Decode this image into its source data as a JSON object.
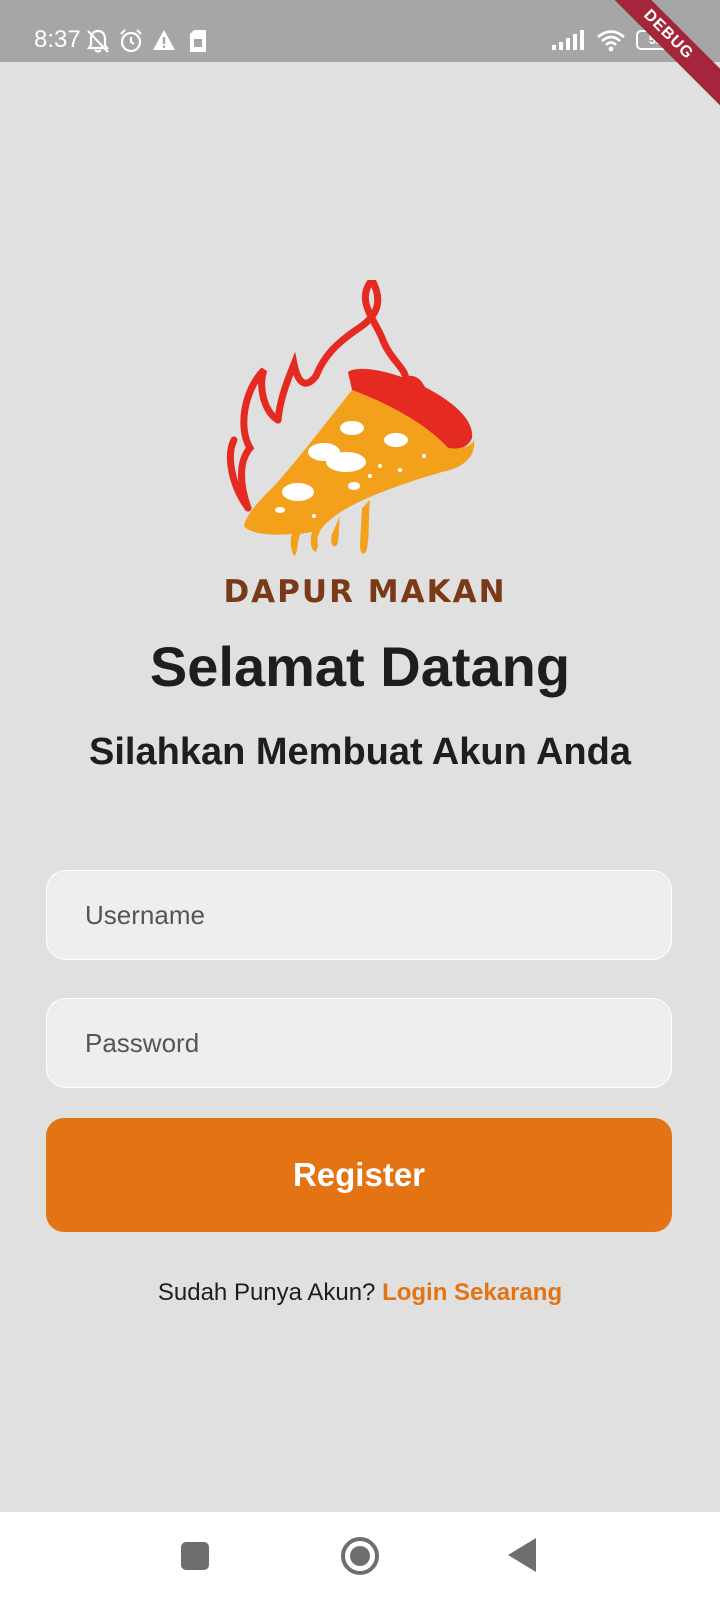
{
  "status_bar": {
    "time": "8:37",
    "battery": "52",
    "icons": [
      "notifications-off-icon",
      "alarm-icon",
      "warning-icon",
      "sim-icon",
      "signal-icon",
      "wifi-icon",
      "battery-icon"
    ]
  },
  "debug_banner": "DEBUG",
  "logo": {
    "brand_name": "DAPUR MAKAN",
    "icon": "pizza-flame-logo"
  },
  "header": {
    "title": "Selamat Datang",
    "subtitle": "Silahkan Membuat Akun Anda"
  },
  "form": {
    "username_placeholder": "Username",
    "username_value": "",
    "password_placeholder": "Password",
    "password_value": "",
    "register_label": "Register"
  },
  "footer": {
    "prompt": "Sudah Punya Akun?",
    "login_link": "Login Sekarang"
  },
  "nav_bar": {
    "recents": "recents-icon",
    "home": "home-icon",
    "back": "back-icon"
  },
  "colors": {
    "accent": "#e37313",
    "background": "#e0e0e0",
    "status_bar": "#a6a6a6",
    "brand_text": "#7a3a18"
  }
}
